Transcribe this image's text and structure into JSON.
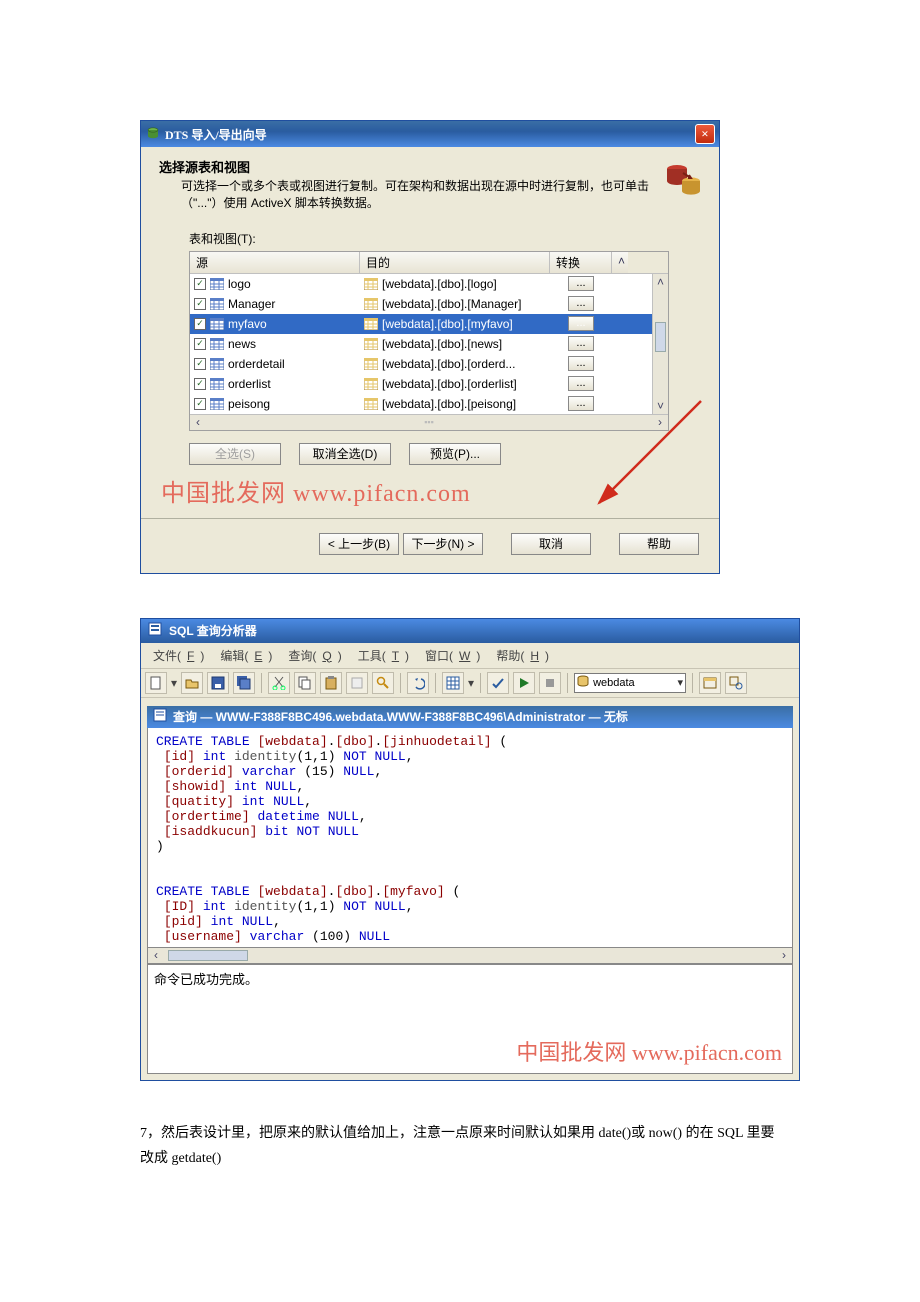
{
  "dts": {
    "window_title": "DTS 导入/导出向导",
    "header_title": "选择源表和视图",
    "header_desc": "可选择一个或多个表或视图进行复制。可在架构和数据出现在源中时进行复制，也可单击（\"...\"）使用 ActiveX 脚本转换数据。",
    "table_label": "表和视图(T):",
    "cols": {
      "src": "源",
      "dst": "目的",
      "trn": "转换"
    },
    "rows": [
      {
        "src": "logo",
        "dst": "[webdata].[dbo].[logo]",
        "sel": false
      },
      {
        "src": "Manager",
        "dst": "[webdata].[dbo].[Manager]",
        "sel": false
      },
      {
        "src": "myfavo",
        "dst": "[webdata].[dbo].[myfavo]",
        "sel": true
      },
      {
        "src": "news",
        "dst": "[webdata].[dbo].[news]",
        "sel": false
      },
      {
        "src": "orderdetail",
        "dst": "[webdata].[dbo].[orderd...",
        "sel": false
      },
      {
        "src": "orderlist",
        "dst": "[webdata].[dbo].[orderlist]",
        "sel": false
      },
      {
        "src": "peisong",
        "dst": "[webdata].[dbo].[peisong]",
        "sel": false
      }
    ],
    "dots": "...",
    "btn_select_all": "全选(S)",
    "btn_deselect_all": "取消全选(D)",
    "btn_preview": "预览(P)...",
    "btn_back": "< 上一步(B)",
    "btn_next": "下一步(N) >",
    "btn_cancel": "取消",
    "btn_help": "帮助",
    "watermark": "中国批发网 www.pifacn.com"
  },
  "sql": {
    "window_title": "SQL 查询分析器",
    "menus": {
      "file": {
        "label": "文件",
        "key": "F"
      },
      "edit": {
        "label": "编辑",
        "key": "E"
      },
      "query": {
        "label": "查询",
        "key": "Q"
      },
      "tools": {
        "label": "工具",
        "key": "T"
      },
      "window": {
        "label": "窗口",
        "key": "W"
      },
      "help": {
        "label": "帮助",
        "key": "H"
      }
    },
    "db_name": "webdata",
    "sub_title": "查询 — WWW-F388F8BC496.webdata.WWW-F388F8BC496\\Administrator — 无标",
    "code_lines": [
      "CREATE TABLE [webdata].[dbo].[jinhuodetail] (",
      " [id] int identity(1,1) NOT NULL,",
      " [orderid] varchar (15) NULL,",
      " [showid] int NULL,",
      " [quatity] int NULL,",
      " [ordertime] datetime NULL,",
      " [isaddkucun] bit NOT NULL",
      ")",
      "",
      "",
      "CREATE TABLE [webdata].[dbo].[myfavo] (",
      " [ID] int identity(1,1) NOT NULL,",
      " [pid] int NULL,",
      " [username] varchar (100) NULL"
    ],
    "output_text": "命令已成功完成。",
    "watermark": "中国批发网 www.pifacn.com"
  },
  "doc": {
    "para": "7，然后表设计里，把原来的默认值给加上，注意一点原来时间默认如果用 date()或 now() 的在 SQL 里要改成 getdate()"
  },
  "glyphs": {
    "close": "×",
    "check": "✓",
    "up": "˄",
    "down": "˅",
    "left": "‹",
    "right": "›",
    "dd": "▾"
  }
}
